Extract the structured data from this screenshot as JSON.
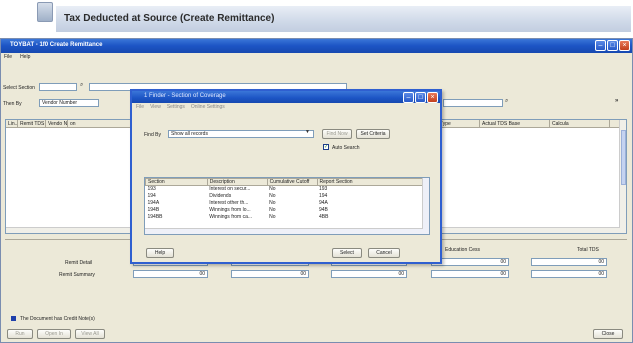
{
  "banner": {
    "title": "Tax Deducted at Source (Create Remittance)"
  },
  "window": {
    "title": "TOYBAT - 1f0 Create Remittance",
    "menu": [
      "File",
      "Help"
    ]
  },
  "filters": {
    "select_section_label": "Select Section",
    "then_by_label": "Then By",
    "then_by_value": "Vendor Number"
  },
  "grid": {
    "columns": [
      "Lin...",
      "Remit TDS",
      "Vendo Nu",
      "on",
      "Service Type",
      "Actual TDS Base",
      "Calcula"
    ]
  },
  "totals": {
    "col_headers": [
      "Education Cess",
      "Total TDS"
    ],
    "rows": [
      {
        "label": "Remit Detail",
        "values": [
          "00",
          "00",
          "00",
          "00",
          "00"
        ]
      },
      {
        "label": "Remit Summary",
        "values": [
          "00",
          "00",
          "00",
          "00",
          "00"
        ]
      }
    ]
  },
  "footer": {
    "checkbox_label": "The Document has Credit Note(s)",
    "buttons": [
      "Run",
      "Open In",
      "View All"
    ],
    "close_label": "Close"
  },
  "dialog": {
    "title": "1 Finder - Section of Coverage",
    "menu": [
      "File",
      "View",
      "Settings",
      "Online Settings"
    ],
    "find_by_label": "Find By",
    "find_by_value": "Show all records",
    "find_now_label": "Find Now",
    "set_criteria_label": "Set Criteria",
    "auto_search_label": "Auto Search",
    "auto_search_checked": true,
    "columns": [
      "Section",
      "Description",
      "Cumulative Cutoff",
      "Report Section"
    ],
    "rows": [
      [
        "193",
        "Interest on secur...",
        "No",
        "193"
      ],
      [
        "194",
        "Dividends",
        "No",
        "194"
      ],
      [
        "194A",
        "Interest other th...",
        "No",
        "94A"
      ],
      [
        "194B",
        "Winnings from lo...",
        "No",
        "94B"
      ],
      [
        "194BB",
        "Winnings from ca...",
        "No",
        "4BB"
      ]
    ],
    "help_label": "Help",
    "select_label": "Select",
    "cancel_label": "Cancel"
  },
  "colors": {
    "title_blue": "#1c54c4",
    "window_bg": "#ece9d8",
    "check_blue": "#1f3faa"
  }
}
